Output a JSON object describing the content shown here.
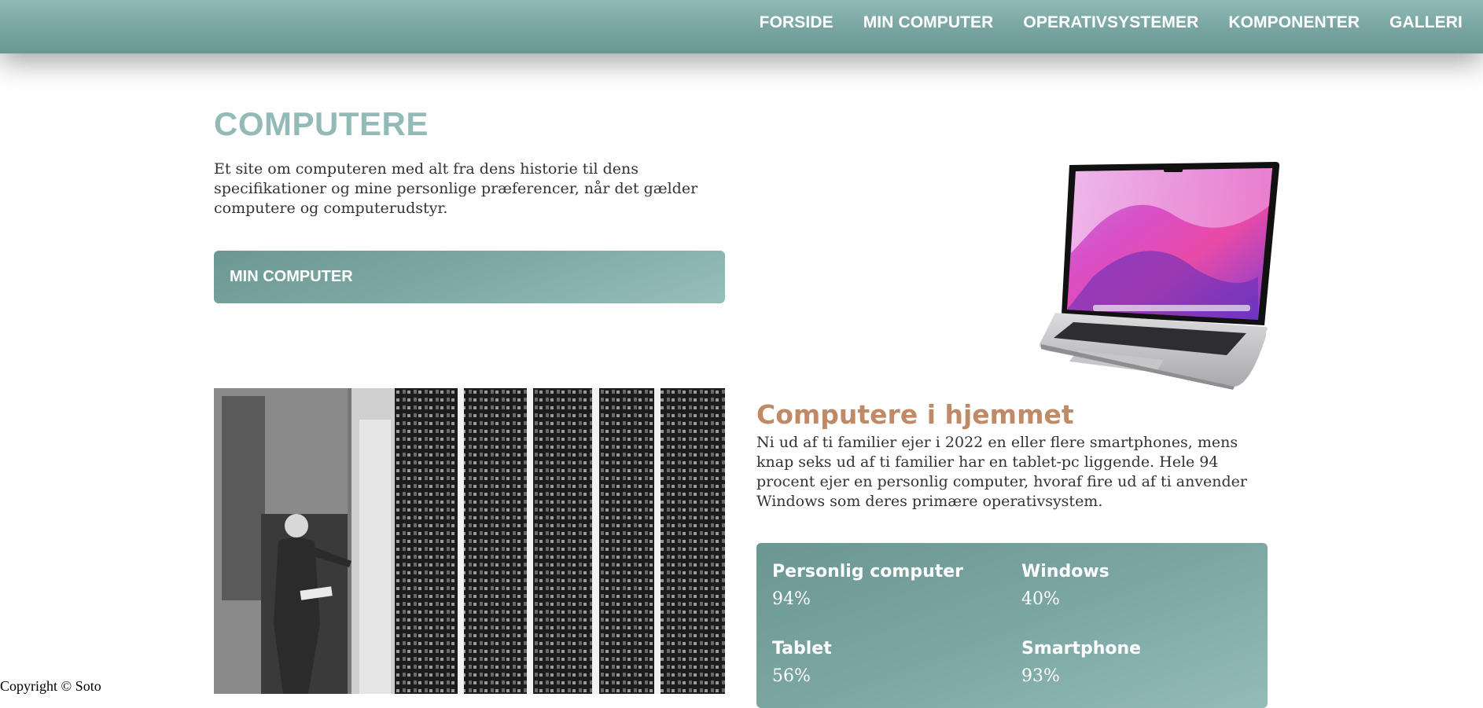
{
  "nav": {
    "items": [
      {
        "label": "FORSIDE"
      },
      {
        "label": "MIN COMPUTER"
      },
      {
        "label": "OPERATIVSYSTEMER"
      },
      {
        "label": "KOMPONENTER"
      },
      {
        "label": "GALLERI"
      }
    ]
  },
  "hero": {
    "title": "COMPUTERE",
    "intro": "Et site om computeren med alt fra dens historie til dens specifikationer og mine personlige præferencer, når det gælder computere og computerudstyr.",
    "button_label": "MIN COMPUTER"
  },
  "home_section": {
    "title": "Computere i hjemmet",
    "text": "Ni ud af ti familier ejer i 2022 en eller flere smartphones, mens knap seks ud af ti familier har en tablet-pc liggende. Hele 94 procent ejer en personlig computer, hvoraf fire ud af ti anvender Windows som deres primære operativsystem."
  },
  "stats": [
    {
      "label": "Personlig computer",
      "value": "94%"
    },
    {
      "label": "Windows",
      "value": "40%"
    },
    {
      "label": "Tablet",
      "value": "56%"
    },
    {
      "label": "Smartphone",
      "value": "93%"
    }
  ],
  "footer": {
    "copyright": "Copyright © Soto"
  },
  "colors": {
    "nav_bg": "#7aa7a3",
    "title": "#92bab6",
    "accent_orange": "#c08a66",
    "text": "#333333"
  },
  "images": {
    "laptop": "laptop-image",
    "photo": "historic-computer-room-photo"
  }
}
